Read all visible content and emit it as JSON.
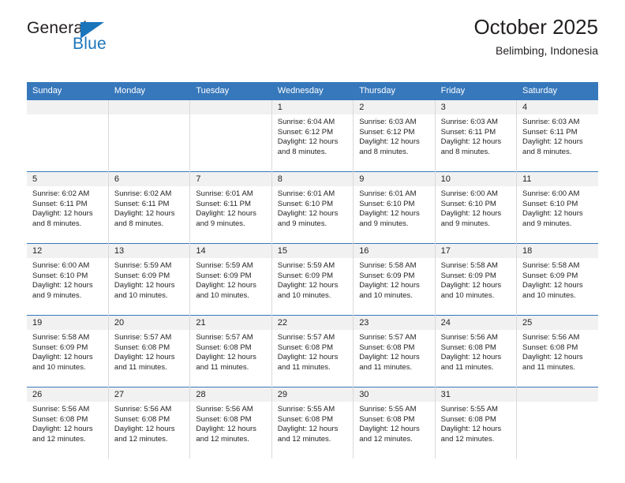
{
  "brand": {
    "name_part1": "General",
    "name_part2": "Blue",
    "triangle_color": "#1b75bb",
    "text_color": "#231f20"
  },
  "header": {
    "title": "October 2025",
    "subtitle": "Belimbing, Indonesia"
  },
  "theme": {
    "header_blue": "#3778bc",
    "daynum_band": "#f1f1f1",
    "cell_border": "#d9d9d9",
    "text": "#231f20"
  },
  "weekday_headers": [
    "Sunday",
    "Monday",
    "Tuesday",
    "Wednesday",
    "Thursday",
    "Friday",
    "Saturday"
  ],
  "labels": {
    "sunrise_prefix": "Sunrise:",
    "sunset_prefix": "Sunset:",
    "daylight_prefix": "Daylight:"
  },
  "weeks": [
    [
      {
        "empty": true
      },
      {
        "empty": true
      },
      {
        "empty": true
      },
      {
        "day": "1",
        "sunrise": "Sunrise: 6:04 AM",
        "sunset": "Sunset: 6:12 PM",
        "daylight_line1": "Daylight: 12 hours",
        "daylight_line2": "and 8 minutes."
      },
      {
        "day": "2",
        "sunrise": "Sunrise: 6:03 AM",
        "sunset": "Sunset: 6:12 PM",
        "daylight_line1": "Daylight: 12 hours",
        "daylight_line2": "and 8 minutes."
      },
      {
        "day": "3",
        "sunrise": "Sunrise: 6:03 AM",
        "sunset": "Sunset: 6:11 PM",
        "daylight_line1": "Daylight: 12 hours",
        "daylight_line2": "and 8 minutes."
      },
      {
        "day": "4",
        "sunrise": "Sunrise: 6:03 AM",
        "sunset": "Sunset: 6:11 PM",
        "daylight_line1": "Daylight: 12 hours",
        "daylight_line2": "and 8 minutes."
      }
    ],
    [
      {
        "day": "5",
        "sunrise": "Sunrise: 6:02 AM",
        "sunset": "Sunset: 6:11 PM",
        "daylight_line1": "Daylight: 12 hours",
        "daylight_line2": "and 8 minutes."
      },
      {
        "day": "6",
        "sunrise": "Sunrise: 6:02 AM",
        "sunset": "Sunset: 6:11 PM",
        "daylight_line1": "Daylight: 12 hours",
        "daylight_line2": "and 8 minutes."
      },
      {
        "day": "7",
        "sunrise": "Sunrise: 6:01 AM",
        "sunset": "Sunset: 6:11 PM",
        "daylight_line1": "Daylight: 12 hours",
        "daylight_line2": "and 9 minutes."
      },
      {
        "day": "8",
        "sunrise": "Sunrise: 6:01 AM",
        "sunset": "Sunset: 6:10 PM",
        "daylight_line1": "Daylight: 12 hours",
        "daylight_line2": "and 9 minutes."
      },
      {
        "day": "9",
        "sunrise": "Sunrise: 6:01 AM",
        "sunset": "Sunset: 6:10 PM",
        "daylight_line1": "Daylight: 12 hours",
        "daylight_line2": "and 9 minutes."
      },
      {
        "day": "10",
        "sunrise": "Sunrise: 6:00 AM",
        "sunset": "Sunset: 6:10 PM",
        "daylight_line1": "Daylight: 12 hours",
        "daylight_line2": "and 9 minutes."
      },
      {
        "day": "11",
        "sunrise": "Sunrise: 6:00 AM",
        "sunset": "Sunset: 6:10 PM",
        "daylight_line1": "Daylight: 12 hours",
        "daylight_line2": "and 9 minutes."
      }
    ],
    [
      {
        "day": "12",
        "sunrise": "Sunrise: 6:00 AM",
        "sunset": "Sunset: 6:10 PM",
        "daylight_line1": "Daylight: 12 hours",
        "daylight_line2": "and 9 minutes."
      },
      {
        "day": "13",
        "sunrise": "Sunrise: 5:59 AM",
        "sunset": "Sunset: 6:09 PM",
        "daylight_line1": "Daylight: 12 hours",
        "daylight_line2": "and 10 minutes."
      },
      {
        "day": "14",
        "sunrise": "Sunrise: 5:59 AM",
        "sunset": "Sunset: 6:09 PM",
        "daylight_line1": "Daylight: 12 hours",
        "daylight_line2": "and 10 minutes."
      },
      {
        "day": "15",
        "sunrise": "Sunrise: 5:59 AM",
        "sunset": "Sunset: 6:09 PM",
        "daylight_line1": "Daylight: 12 hours",
        "daylight_line2": "and 10 minutes."
      },
      {
        "day": "16",
        "sunrise": "Sunrise: 5:58 AM",
        "sunset": "Sunset: 6:09 PM",
        "daylight_line1": "Daylight: 12 hours",
        "daylight_line2": "and 10 minutes."
      },
      {
        "day": "17",
        "sunrise": "Sunrise: 5:58 AM",
        "sunset": "Sunset: 6:09 PM",
        "daylight_line1": "Daylight: 12 hours",
        "daylight_line2": "and 10 minutes."
      },
      {
        "day": "18",
        "sunrise": "Sunrise: 5:58 AM",
        "sunset": "Sunset: 6:09 PM",
        "daylight_line1": "Daylight: 12 hours",
        "daylight_line2": "and 10 minutes."
      }
    ],
    [
      {
        "day": "19",
        "sunrise": "Sunrise: 5:58 AM",
        "sunset": "Sunset: 6:09 PM",
        "daylight_line1": "Daylight: 12 hours",
        "daylight_line2": "and 10 minutes."
      },
      {
        "day": "20",
        "sunrise": "Sunrise: 5:57 AM",
        "sunset": "Sunset: 6:08 PM",
        "daylight_line1": "Daylight: 12 hours",
        "daylight_line2": "and 11 minutes."
      },
      {
        "day": "21",
        "sunrise": "Sunrise: 5:57 AM",
        "sunset": "Sunset: 6:08 PM",
        "daylight_line1": "Daylight: 12 hours",
        "daylight_line2": "and 11 minutes."
      },
      {
        "day": "22",
        "sunrise": "Sunrise: 5:57 AM",
        "sunset": "Sunset: 6:08 PM",
        "daylight_line1": "Daylight: 12 hours",
        "daylight_line2": "and 11 minutes."
      },
      {
        "day": "23",
        "sunrise": "Sunrise: 5:57 AM",
        "sunset": "Sunset: 6:08 PM",
        "daylight_line1": "Daylight: 12 hours",
        "daylight_line2": "and 11 minutes."
      },
      {
        "day": "24",
        "sunrise": "Sunrise: 5:56 AM",
        "sunset": "Sunset: 6:08 PM",
        "daylight_line1": "Daylight: 12 hours",
        "daylight_line2": "and 11 minutes."
      },
      {
        "day": "25",
        "sunrise": "Sunrise: 5:56 AM",
        "sunset": "Sunset: 6:08 PM",
        "daylight_line1": "Daylight: 12 hours",
        "daylight_line2": "and 11 minutes."
      }
    ],
    [
      {
        "day": "26",
        "sunrise": "Sunrise: 5:56 AM",
        "sunset": "Sunset: 6:08 PM",
        "daylight_line1": "Daylight: 12 hours",
        "daylight_line2": "and 12 minutes."
      },
      {
        "day": "27",
        "sunrise": "Sunrise: 5:56 AM",
        "sunset": "Sunset: 6:08 PM",
        "daylight_line1": "Daylight: 12 hours",
        "daylight_line2": "and 12 minutes."
      },
      {
        "day": "28",
        "sunrise": "Sunrise: 5:56 AM",
        "sunset": "Sunset: 6:08 PM",
        "daylight_line1": "Daylight: 12 hours",
        "daylight_line2": "and 12 minutes."
      },
      {
        "day": "29",
        "sunrise": "Sunrise: 5:55 AM",
        "sunset": "Sunset: 6:08 PM",
        "daylight_line1": "Daylight: 12 hours",
        "daylight_line2": "and 12 minutes."
      },
      {
        "day": "30",
        "sunrise": "Sunrise: 5:55 AM",
        "sunset": "Sunset: 6:08 PM",
        "daylight_line1": "Daylight: 12 hours",
        "daylight_line2": "and 12 minutes."
      },
      {
        "day": "31",
        "sunrise": "Sunrise: 5:55 AM",
        "sunset": "Sunset: 6:08 PM",
        "daylight_line1": "Daylight: 12 hours",
        "daylight_line2": "and 12 minutes."
      },
      {
        "empty": true
      }
    ]
  ]
}
